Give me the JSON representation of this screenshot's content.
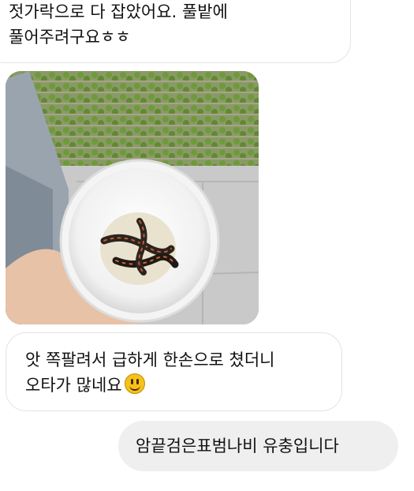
{
  "messages": [
    {
      "sender": "other",
      "lines": [
        "젓가락으로 다 잡았어요. 풀밭에",
        "풀어주려구요ㅎㅎ"
      ]
    },
    {
      "sender": "other",
      "type": "photo",
      "description_icon": "cup-with-caterpillars"
    },
    {
      "sender": "other",
      "lines": [
        "앗 쪽팔려서 급하게 한손으로 쳤더니",
        "오타가 많네요"
      ],
      "emoji": "grinning-face"
    },
    {
      "sender": "me",
      "lines": [
        "암끝검은표범나비 유충입니다"
      ]
    }
  ],
  "colors": {
    "incoming_bubble": "#ffffff",
    "outgoing_bubble": "#efefef",
    "text": "#111111"
  }
}
